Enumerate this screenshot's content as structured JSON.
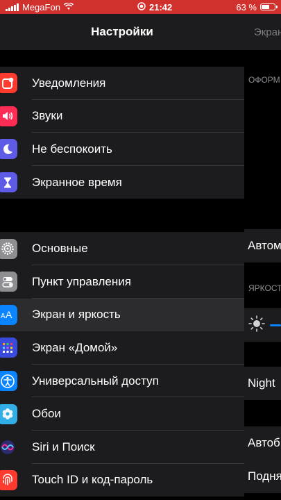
{
  "status_bar": {
    "carrier": "MegaFon",
    "time": "21:42",
    "battery": "63 %",
    "battery_level": 0.63
  },
  "master": {
    "title": "Настройки",
    "groups": [
      {
        "items": [
          {
            "label": "Уведомления",
            "icon": "notifications-icon",
            "color": "#ff3b30"
          },
          {
            "label": "Звуки",
            "icon": "speaker-icon",
            "color": "#ff2d55"
          },
          {
            "label": "Не беспокоить",
            "icon": "moon-icon",
            "color": "#5e5ce6"
          },
          {
            "label": "Экранное время",
            "icon": "hourglass-icon",
            "color": "#5e5ce6"
          }
        ]
      },
      {
        "items": [
          {
            "label": "Основные",
            "icon": "gear-icon",
            "color": "#8e8e93"
          },
          {
            "label": "Пункт управления",
            "icon": "toggles-icon",
            "color": "#8e8e93"
          },
          {
            "label": "Экран и яркость",
            "icon": "aa-icon",
            "color": "#0a84ff",
            "selected": true
          },
          {
            "label": "Экран «Домой»",
            "icon": "home-grid-icon",
            "color": "#3a4bdc"
          },
          {
            "label": "Универсальный доступ",
            "icon": "accessibility-icon",
            "color": "#0a84ff"
          },
          {
            "label": "Обои",
            "icon": "flower-icon",
            "color": "#32ade6"
          },
          {
            "label": "Siri и Поиск",
            "icon": "siri-icon",
            "color": "#1c1c1e"
          },
          {
            "label": "Touch ID и код-пароль",
            "icon": "fingerprint-icon",
            "color": "#ff3b30"
          }
        ]
      }
    ]
  },
  "detail": {
    "title": "Экран",
    "section_appearance": "ОФОРМ",
    "automatic": "Автом",
    "section_brightness": "ЯРКОСТ",
    "night": "Night",
    "auto_brightness": "Автоб",
    "raise": "Подня"
  }
}
